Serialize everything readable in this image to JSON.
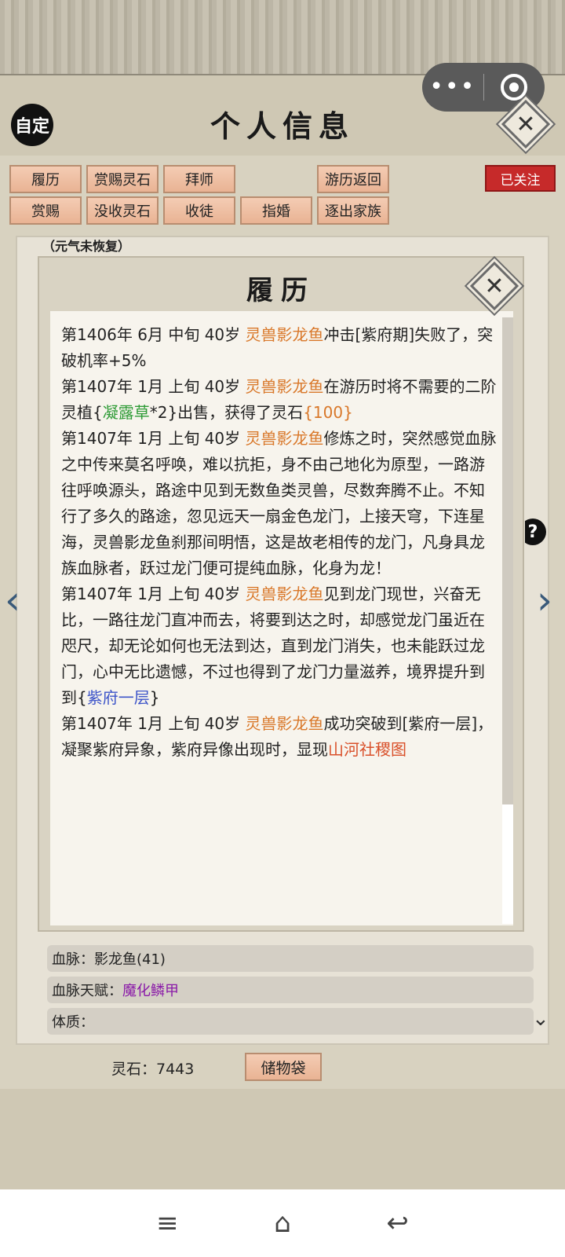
{
  "capsule": {
    "more_icon": "more-dots-icon",
    "close_icon": "target-circle-icon"
  },
  "header": {
    "auto_label": "自定",
    "title": "个人信息"
  },
  "actions": {
    "row1": [
      "履历",
      "赏赐灵石",
      "拜师",
      "游历返回"
    ],
    "row2": [
      "赏赐",
      "没收灵石",
      "收徒",
      "指婚",
      "逐出家族"
    ],
    "followed": "已关注"
  },
  "background": {
    "vital_status": "（元气未恢复）",
    "rows": {
      "bloodline_label": "血脉：",
      "bloodline_value": "影龙鱼(41)",
      "talent_label": "血脉天赋：",
      "talent_value": "魔化鳞甲",
      "physique_label": "体质："
    },
    "spirit_stone": "灵石：7443",
    "bag_button": "储物袋"
  },
  "modal": {
    "title": "履历",
    "entries": [
      [
        {
          "t": "第1406年 6月 中旬 40岁 "
        },
        {
          "t": "灵兽影龙鱼",
          "c": "org"
        },
        {
          "t": "冲击[紫府期]失败了，突破机率+5%"
        }
      ],
      [
        {
          "t": "第1407年 1月 上旬 40岁 "
        },
        {
          "t": "灵兽影龙鱼",
          "c": "org"
        },
        {
          "t": "在游历时将不需要的二阶灵植{"
        },
        {
          "t": "凝露草",
          "c": "grn"
        },
        {
          "t": "*2}出售，获得了灵石"
        },
        {
          "t": "{100}",
          "c": "org"
        }
      ],
      [
        {
          "t": "第1407年 1月 上旬 40岁 "
        },
        {
          "t": "灵兽影龙鱼",
          "c": "org"
        },
        {
          "t": "修炼之时，突然感觉血脉之中传来莫名呼唤，难以抗拒，身不由己地化为原型，一路游往呼唤源头，路途中见到无数鱼类灵兽，尽数奔腾不止。不知行了多久的路途，忽见远天一扇金色龙门，上接天穹，下连星海，灵兽影龙鱼刹那间明悟，这是故老相传的龙门，凡身具龙族血脉者，跃过龙门便可提纯血脉，化身为龙！"
        }
      ],
      [
        {
          "t": "第1407年 1月 上旬 40岁 "
        },
        {
          "t": "灵兽影龙鱼",
          "c": "org"
        },
        {
          "t": "见到龙门现世，兴奋无比，一路往龙门直冲而去，将要到达之时，却感觉龙门虽近在咫尺，却无论如何也无法到达，直到龙门消失，也未能跃过龙门，心中无比遗憾，不过也得到了龙门力量滋养，境界提升到到{"
        },
        {
          "t": "紫府一层",
          "c": "blu"
        },
        {
          "t": "}"
        }
      ],
      [
        {
          "t": "第1407年 1月 上旬 40岁 "
        },
        {
          "t": "灵兽影龙鱼",
          "c": "org"
        },
        {
          "t": "成功突破到[紫府一层]，凝聚紫府异象，紫府异像出现时，显现"
        },
        {
          "t": "山河社稷图",
          "c": "red"
        }
      ]
    ]
  },
  "navbar": {
    "menu": "≡",
    "home": "⌂",
    "back": "↩"
  },
  "colors": {
    "accent_orange": "#d9782a",
    "green": "#2e9b36",
    "blue": "#3d54c9",
    "red_tag": "#c62a2a",
    "button_peach": "#f4ccb4"
  }
}
